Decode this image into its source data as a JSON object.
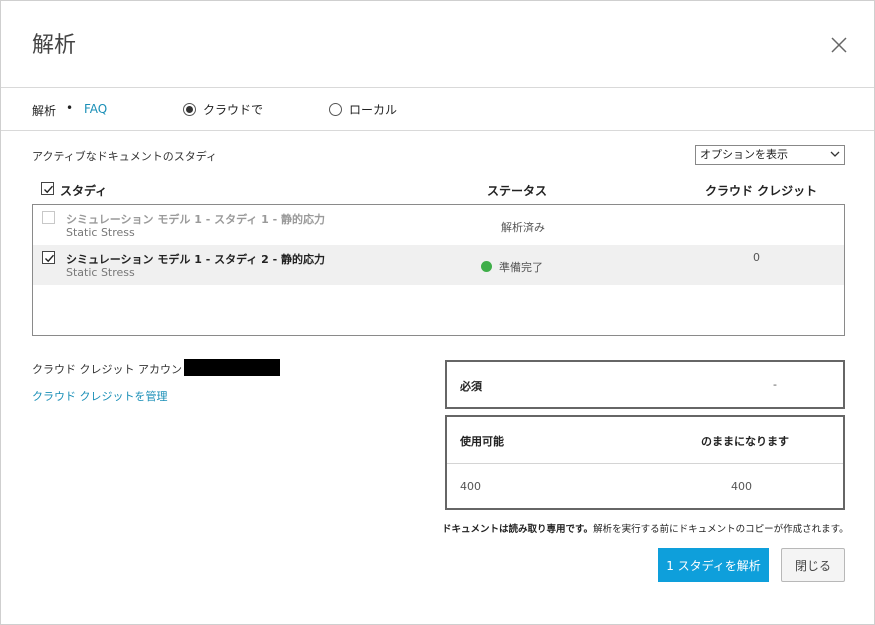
{
  "dialog": {
    "title": "解析",
    "close_icon": "close-icon"
  },
  "subbar": {
    "analysis_label": "解析",
    "separator": "•",
    "faq_link": "FAQ",
    "radio_cloud": {
      "label": "クラウドで",
      "selected": true
    },
    "radio_local": {
      "label": "ローカル",
      "selected": false
    }
  },
  "studies": {
    "section_label": "アクティブなドキュメントのスタディ",
    "options_select": {
      "selected": "オプションを表示"
    },
    "columns": {
      "study": "スタディ",
      "status": "ステータス",
      "credits": "クラウド クレジット"
    },
    "header_checked": true,
    "rows": [
      {
        "name": "シミュレーション モデル 1 - スタディ 1 - 静的応力",
        "type": "Static Stress",
        "status": "解析済み",
        "credits": "",
        "checked": false,
        "disabled": true,
        "status_icon": ""
      },
      {
        "name": "シミュレーション モデル 1 - スタディ 2 - 静的応力",
        "type": "Static Stress",
        "status": "準備完了",
        "credits": "0",
        "checked": true,
        "disabled": false,
        "status_icon": "ready-dot-icon"
      }
    ]
  },
  "account": {
    "label": "クラウド クレジット アカウント",
    "manage_link": "クラウド クレジットを管理"
  },
  "credits": {
    "required_label": "必須",
    "required_value": "-",
    "available_label": "使用可能",
    "remaining_label": "のままになります",
    "available_value": "400",
    "remaining_value": "400"
  },
  "footer": {
    "note_bold": "ドキュメントは読み取り専用です。",
    "note_rest": "解析を実行する前にドキュメントのコピーが作成されます。",
    "primary_button": "1 スタディを解析",
    "close_button": "閉じる"
  },
  "colors": {
    "accent": "#0e9fdb",
    "link": "#1a8fb7",
    "ready": "#3fae49"
  }
}
